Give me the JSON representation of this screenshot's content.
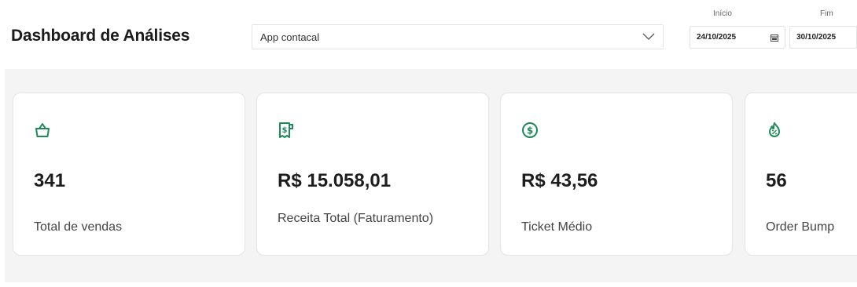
{
  "header": {
    "title": "Dashboard de Análises",
    "app_select": {
      "value": "App contacal"
    },
    "start_date": {
      "label": "Início",
      "value": "24/10/2025"
    },
    "end_date": {
      "label": "Fim",
      "value": "30/10/2025"
    }
  },
  "colors": {
    "accent": "#1e8a5a",
    "background": "#f4f4f4"
  },
  "cards": [
    {
      "icon": "basket-icon",
      "value": "341",
      "label": "Total de vendas"
    },
    {
      "icon": "receipt-dollar-icon",
      "value": "R$ 15.058,01",
      "label": "Receita Total (Faturamento)"
    },
    {
      "icon": "dollar-circle-icon",
      "value": "R$ 43,56",
      "label": "Ticket Médio"
    },
    {
      "icon": "order-bump-icon",
      "value": "56",
      "label": "Order Bump"
    }
  ]
}
